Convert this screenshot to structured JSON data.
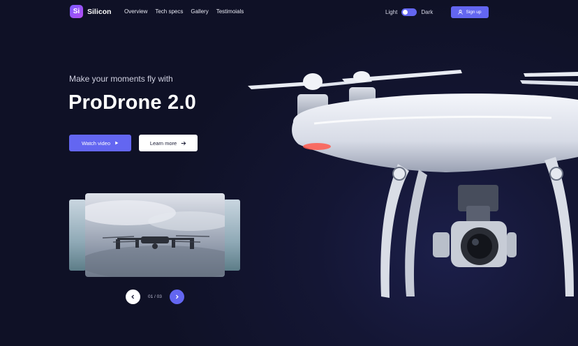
{
  "brand": {
    "mark": "Si",
    "name": "Silicon"
  },
  "nav": [
    "Overview",
    "Tech specs",
    "Gallery",
    "Testimoials"
  ],
  "theme": {
    "light_label": "Light",
    "dark_label": "Dark",
    "mode": "dark"
  },
  "signup_label": "Sign up",
  "hero": {
    "subtitle": "Make your moments fly with",
    "title": "ProDrone 2.0"
  },
  "buttons": {
    "watch": "Watch video",
    "learn": "Learn more"
  },
  "gallery": {
    "counter": "01 / 03",
    "current": 1,
    "total": 3
  },
  "colors": {
    "accent": "#6366f1",
    "background": "#141634"
  }
}
